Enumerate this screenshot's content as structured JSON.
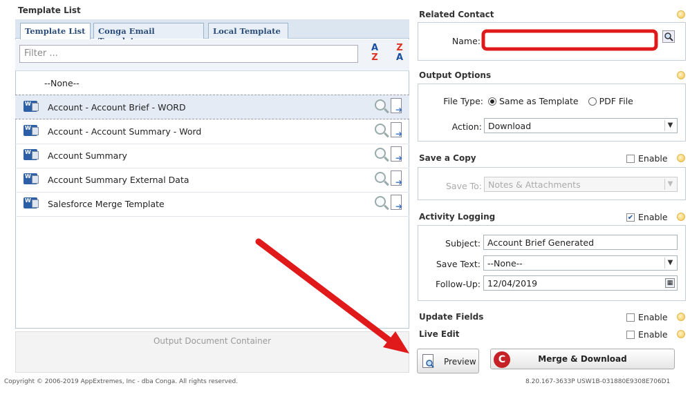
{
  "template_list": {
    "title": "Template List",
    "tabs": [
      "Template List",
      "Conga Email Templates",
      "Local Template"
    ],
    "filter_placeholder": "Filter ...",
    "sort_az": "A↓Z",
    "sort_za": "Z↓A",
    "items": [
      "--None--",
      "Account - Account Brief - WORD",
      "Account - Account Summary - Word",
      "Account Summary",
      "Account Summary External Data",
      "Salesforce Merge Template"
    ],
    "output_container": "Output Document Container"
  },
  "footer": {
    "copyright": "Copyright © 2006-2019 AppExtremes, Inc - dba Conga. All rights reserved.",
    "version": "8.20.167-3633P USW1B-031880E9308E706D1"
  },
  "related_contact": {
    "title": "Related Contact",
    "name_label": "Name:",
    "name_value": ""
  },
  "output_options": {
    "title": "Output Options",
    "file_type_label": "File Type:",
    "radio_same": "Same as Template",
    "radio_pdf": "PDF File",
    "action_label": "Action:",
    "action_value": "Download"
  },
  "save_copy": {
    "title": "Save a Copy",
    "enable_label": "Enable",
    "enabled": false,
    "save_to_label": "Save To:",
    "save_to_value": "Notes & Attachments"
  },
  "activity_logging": {
    "title": "Activity Logging",
    "enable_label": "Enable",
    "enabled": true,
    "subject_label": "Subject:",
    "subject_value": "Account Brief Generated",
    "save_text_label": "Save Text:",
    "save_text_value": "--None--",
    "follow_up_label": "Follow-Up:",
    "follow_up_value": "12/04/2019"
  },
  "update_fields": {
    "title": "Update Fields",
    "enable_label": "Enable"
  },
  "live_edit": {
    "title": "Live Edit",
    "enable_label": "Enable"
  },
  "buttons": {
    "preview": "Preview",
    "merge": "Merge & Download"
  },
  "colors": {
    "annotation_red": "#e0191a",
    "conga_red": "#c62127",
    "tab_text": "#2a4d7a"
  }
}
